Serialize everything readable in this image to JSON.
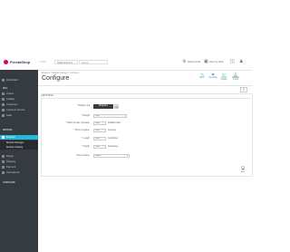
{
  "topbar": {
    "logo": "PrestaShop",
    "version": "1.7.8.8",
    "quick_access": "Quick Access ▾",
    "search_placeholder": "Search",
    "links": [
      "Debug mode",
      "View my shop"
    ]
  },
  "sidebar": {
    "items": [
      {
        "label": "Dashboard",
        "type": "item"
      },
      {
        "label": "SELL",
        "type": "head"
      },
      {
        "label": "Orders",
        "type": "item"
      },
      {
        "label": "Catalog",
        "type": "item"
      },
      {
        "label": "Customers",
        "type": "item"
      },
      {
        "label": "Customer Service",
        "type": "item"
      },
      {
        "label": "Stats",
        "type": "item"
      },
      {
        "label": "IMPROVE",
        "type": "head"
      },
      {
        "label": "Modules",
        "type": "active"
      },
      {
        "label": "Module Manager",
        "type": "sub"
      },
      {
        "label": "Module Catalog",
        "type": "sub"
      },
      {
        "label": "Design",
        "type": "item"
      },
      {
        "label": "Shipping",
        "type": "item"
      },
      {
        "label": "Payment",
        "type": "item"
      },
      {
        "label": "International",
        "type": "item"
      },
      {
        "label": "CONFIGURE",
        "type": "head"
      }
    ]
  },
  "header": {
    "breadcrumb": "Modules  /  Module Manager  /  Configure",
    "title": "Configure",
    "buttons": [
      "Back",
      "Translate",
      "Check update",
      "Manage hooks"
    ]
  },
  "panel": {
    "title": "SETTINGS",
    "fields": [
      {
        "label": "* Weight unit",
        "value": "Kilograms",
        "kind": "segment"
      },
      {
        "label": "* Weight",
        "value": "0.00",
        "unit": ""
      },
      {
        "label": "* Refill Sender Operator",
        "value": "0.00",
        "unit": "Fulfilled order"
      },
      {
        "label": "* Price of option",
        "value": "0.00",
        "unit": "Currency"
      },
      {
        "label": "* Length",
        "value": "0.00",
        "unit": "Centimeter"
      },
      {
        "label": "* Height",
        "value": "0.00",
        "unit": "Centimeter"
      },
      {
        "label": "Parcel status",
        "value": "Select",
        "unit": ""
      }
    ],
    "save": "Save"
  },
  "colors": {
    "accent": "#25b9d7",
    "sidebar": "#363a41",
    "brand": "#df0067"
  }
}
